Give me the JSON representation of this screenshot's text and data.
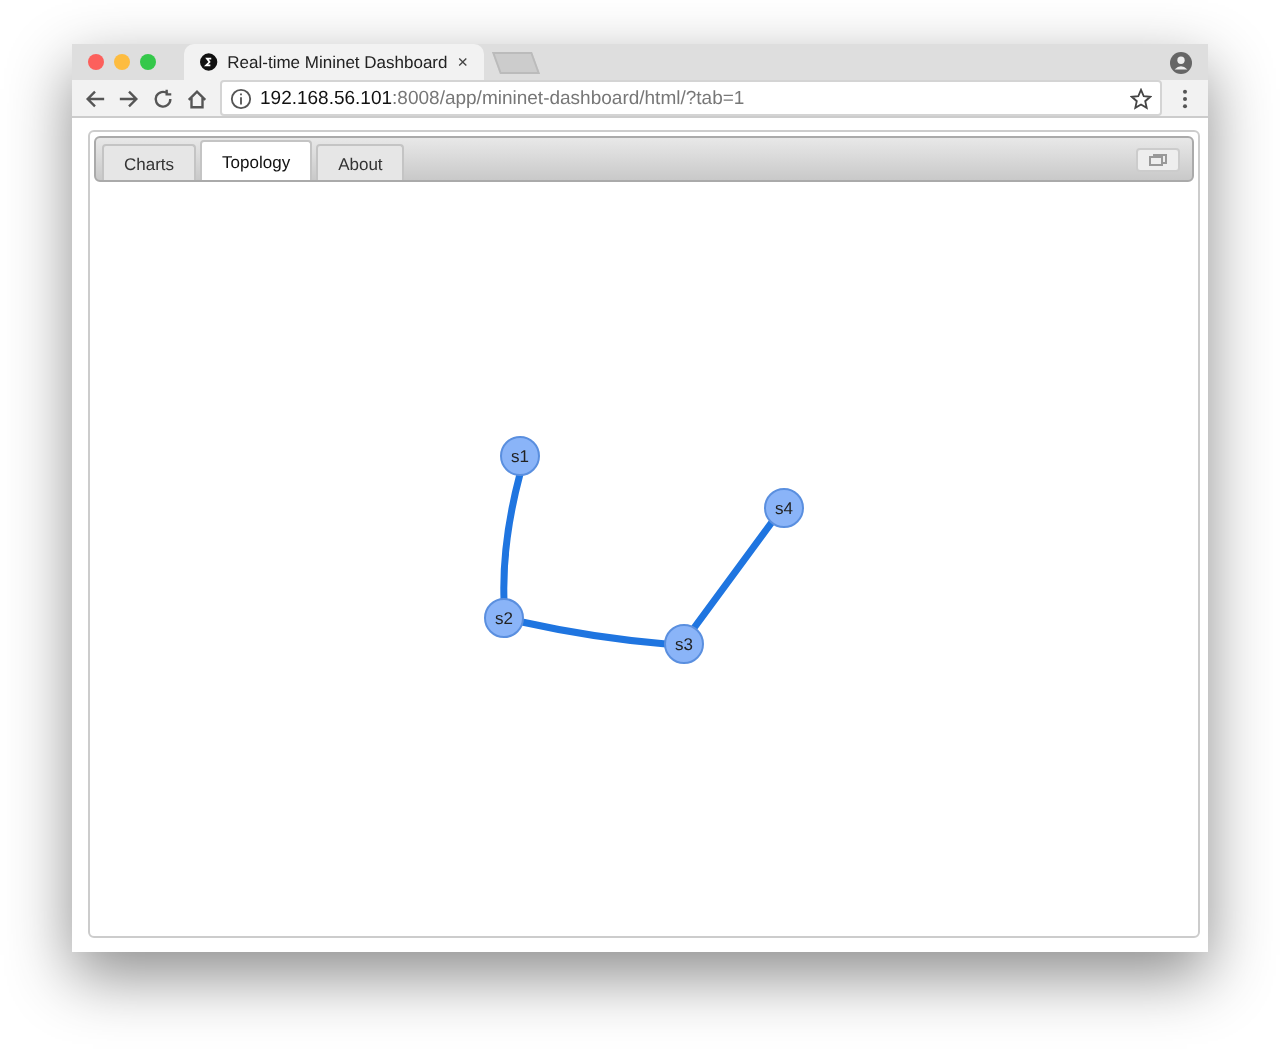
{
  "browser": {
    "tab_title": "Real-time Mininet Dashboard",
    "tab_close": "×",
    "url_host": "192.168.56.101",
    "url_rest": ":8008/app/mininet-dashboard/html/?tab=1"
  },
  "tabs": [
    {
      "label": "Charts",
      "selected": false
    },
    {
      "label": "Topology",
      "selected": true
    },
    {
      "label": "About",
      "selected": false
    }
  ],
  "topology": {
    "nodes": [
      {
        "label": "s1"
      },
      {
        "label": "s2"
      },
      {
        "label": "s3"
      },
      {
        "label": "s4"
      }
    ]
  }
}
